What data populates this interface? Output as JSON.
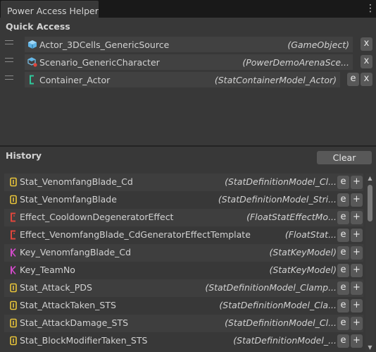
{
  "window": {
    "title": "Power Access Helper",
    "menu_icon": "kebab-menu-icon"
  },
  "quick_access": {
    "title": "Quick Access",
    "items": [
      {
        "name": "Actor_3DCells_GenericSource",
        "type": "(GameObject)",
        "icon": "prefab-cube-icon",
        "has_edit": false,
        "remove_label": "x"
      },
      {
        "name": "Scenario_GenericCharacter",
        "type": "(PowerDemoArenaSce...",
        "icon": "prefab-variant-icon",
        "has_edit": false,
        "remove_label": "x"
      },
      {
        "name": "Container_Actor",
        "type": "(StatContainerModel_Actor)",
        "icon": "stat-container-icon",
        "has_edit": true,
        "edit_label": "e",
        "remove_label": "x"
      }
    ]
  },
  "history": {
    "title": "History",
    "clear_label": "Clear",
    "edit_label": "e",
    "add_label": "+",
    "items": [
      {
        "name": "Stat_VenomfangBlade_Cd",
        "type": "(StatDefinitionModel_Cl...",
        "icon": "stat-definition-icon",
        "icon_color": "#e8c43a"
      },
      {
        "name": "Stat_VenomfangBlade",
        "type": "(StatDefinitionModel_Stri...",
        "icon": "stat-definition-icon",
        "icon_color": "#e8c43a"
      },
      {
        "name": "Effect_CooldownDegeneratorEffect",
        "type": "(FloatStatEffectMo...",
        "icon": "stat-effect-icon",
        "icon_color": "#e0463c"
      },
      {
        "name": "Effect_VenomfangBlade_CdGeneratorEffectTemplate",
        "type": "(FloatStat...",
        "icon": "stat-effect-icon",
        "icon_color": "#e0463c"
      },
      {
        "name": "Key_VenomfangBlade_Cd",
        "type": "(StatKeyModel)",
        "icon": "stat-key-icon",
        "icon_color": "#d04ac8"
      },
      {
        "name": "Key_TeamNo",
        "type": "(StatKeyModel)",
        "icon": "stat-key-icon",
        "icon_color": "#d04ac8"
      },
      {
        "name": "Stat_Attack_PDS",
        "type": "(StatDefinitionModel_Clamp...",
        "icon": "stat-definition-icon",
        "icon_color": "#e8c43a"
      },
      {
        "name": "Stat_AttackTaken_STS",
        "type": "(StatDefinitionModel_Cla...",
        "icon": "stat-definition-icon",
        "icon_color": "#e8c43a"
      },
      {
        "name": "Stat_AttackDamage_STS",
        "type": "(StatDefinitionModel_Cl...",
        "icon": "stat-definition-icon",
        "icon_color": "#e8c43a"
      },
      {
        "name": "Stat_BlockModifierTaken_STS",
        "type": "(StatDefinitionModel_...",
        "icon": "stat-definition-icon",
        "icon_color": "#e8c43a"
      }
    ]
  },
  "colors": {
    "background": "#383838",
    "tabbar": "#191919",
    "button": "#585858",
    "field": "#414141",
    "stat_container_accent": "#2fc79a",
    "prefab_accent": "#5fb4e6",
    "variant_accent": "#e0463c"
  }
}
